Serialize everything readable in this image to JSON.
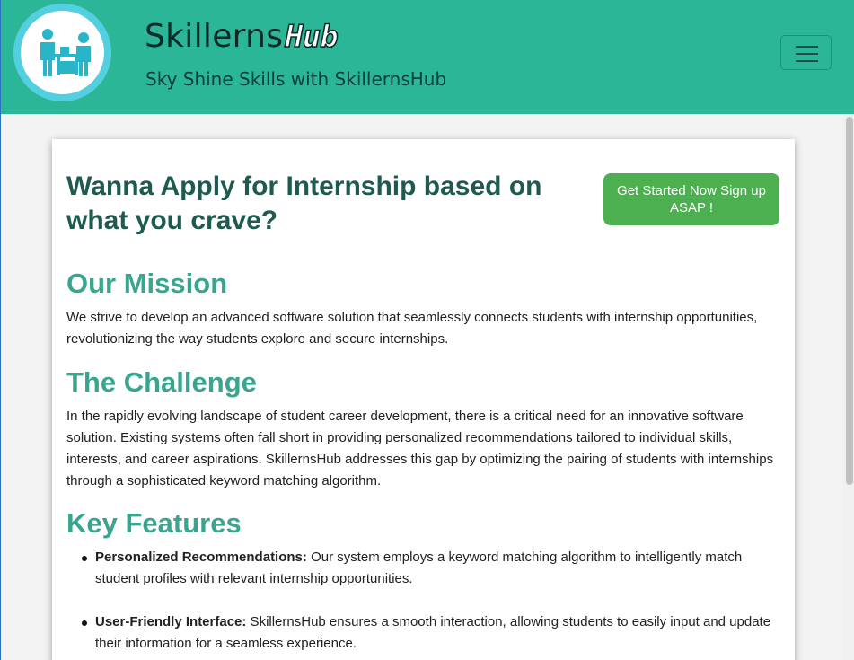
{
  "header": {
    "brand_name": "Skillerns",
    "brand_hub": "Hub",
    "tagline": "Sky Shine Skills with SkillernsHub",
    "menu_icon": "hamburger-menu-icon"
  },
  "colors": {
    "header_bg": "#2bb797",
    "logo_ring": "#54cfe0",
    "heading_dark": "#1e5a50",
    "section_heading": "#3aa58f",
    "cta_bg": "#4caf50"
  },
  "main": {
    "headline": "Wanna Apply for Internship based on what you crave?",
    "cta_label": "Get Started Now Sign up ASAP !",
    "mission": {
      "title": "Our Mission",
      "text": "We strive to develop an advanced software solution that seamlessly connects students with internship opportunities, revolutionizing the way students explore and secure internships."
    },
    "challenge": {
      "title": "The Challenge",
      "text": "In the rapidly evolving landscape of student career development, there is a critical need for an innovative software solution. Existing systems often fall short in providing personalized recommendations tailored to individual skills, interests, and career aspirations. SkillernsHub addresses this gap by optimizing the pairing of students with internships through a sophisticated keyword matching algorithm."
    },
    "features": {
      "title": "Key Features",
      "items": [
        {
          "name": "Personalized Recommendations:",
          "text": " Our system employs a keyword matching algorithm to intelligently match student profiles with relevant internship opportunities."
        },
        {
          "name": "User-Friendly Interface:",
          "text": " SkillernsHub ensures a smooth interaction, allowing students to easily input and update their information for a seamless experience."
        }
      ]
    }
  }
}
